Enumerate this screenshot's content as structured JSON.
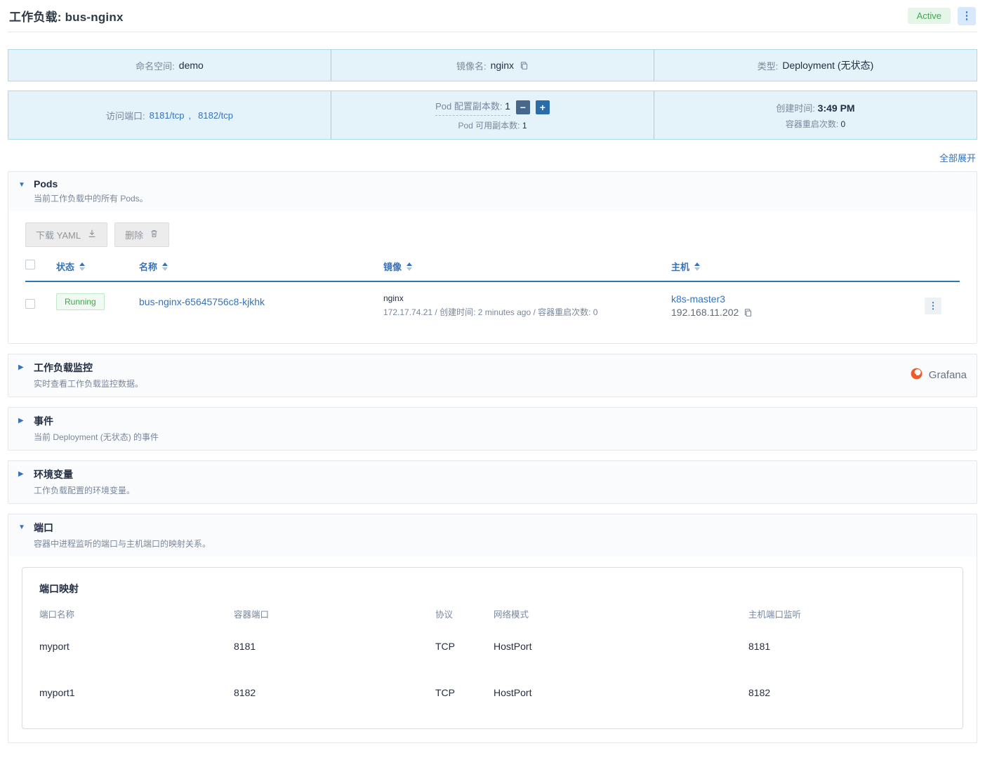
{
  "icons": {
    "kebab": "⋮",
    "triangle_down": "▼",
    "triangle_right": "▶",
    "minus": "−",
    "plus": "+"
  },
  "header": {
    "title": "工作负载: bus-nginx",
    "status_badge": "Active"
  },
  "info_bar1": {
    "namespace_label": "命名空间:",
    "namespace_value": "demo",
    "image_label": "镜像名:",
    "image_value": "nginx",
    "type_label": "类型:",
    "type_value": "Deployment (无状态)"
  },
  "info_bar2": {
    "ports_label": "访问端口:",
    "ports": [
      "8181/tcp",
      "8182/tcp"
    ],
    "ports_sep": ",",
    "replicas_label": "Pod 配置副本数:",
    "replicas_value": "1",
    "available_label": "Pod 可用副本数:",
    "available_value": "1",
    "created_label": "创建时间:",
    "created_value": "3:49 PM",
    "restarts_label": "容器重启次数:",
    "restarts_value": "0"
  },
  "expand_all": "全部展开",
  "sections": {
    "pods": {
      "title": "Pods",
      "subtitle": "当前工作负载中的所有 Pods。",
      "download_button": "下载  YAML",
      "delete_button": "删除",
      "columns": {
        "status": "状态",
        "name": "名称",
        "image": "镜像",
        "host": "主机"
      },
      "row": {
        "status": "Running",
        "name": "bus-nginx-65645756c8-kjkhk",
        "image_name": "nginx",
        "image_detail": "172.17.74.21 / 创建时间: 2 minutes ago / 容器重启次数: 0",
        "host_name": "k8s-master3",
        "host_ip": "192.168.11.202"
      }
    },
    "monitoring": {
      "title": "工作负载监控",
      "subtitle": "实时查看工作负载监控数据。",
      "grafana_label": "Grafana"
    },
    "events": {
      "title": "事件",
      "subtitle": "当前 Deployment (无状态) 的事件"
    },
    "env": {
      "title": "环境变量",
      "subtitle": "工作负载配置的环境变量。"
    },
    "ports": {
      "title": "端口",
      "subtitle": "容器中进程监听的端口与主机端口的映射关系。",
      "card_title": "端口映射",
      "columns": {
        "name": "端口名称",
        "container_port": "容器端口",
        "protocol": "协议",
        "mode": "网络模式",
        "host_port": "主机端口监听"
      },
      "rows": [
        {
          "name": "myport",
          "container_port": "8181",
          "protocol": "TCP",
          "mode": "HostPort",
          "host_port": "8181"
        },
        {
          "name": "myport1",
          "container_port": "8182",
          "protocol": "TCP",
          "mode": "HostPort",
          "host_port": "8182"
        }
      ]
    }
  }
}
